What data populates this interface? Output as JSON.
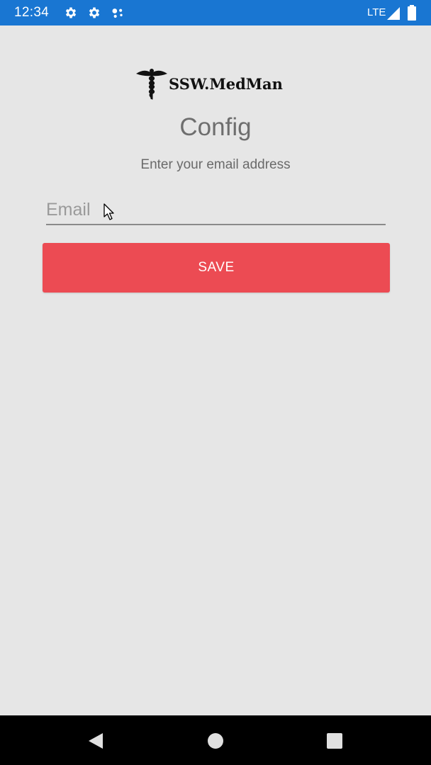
{
  "status_bar": {
    "time": "12:34",
    "network": "LTE",
    "icons": [
      "settings-icon",
      "settings-icon",
      "assistant-dots-icon",
      "signal-icon",
      "battery-icon"
    ],
    "background": "#1976d2"
  },
  "logo": {
    "text": "SSW.MedMan",
    "icon": "caduceus-icon"
  },
  "page": {
    "title": "Config",
    "subtitle": "Enter your email address"
  },
  "form": {
    "email": {
      "value": "",
      "placeholder": "Email"
    },
    "save_label": "SAVE",
    "save_color": "#ec4b53"
  },
  "nav_bar": {
    "buttons": [
      "back-icon",
      "home-icon",
      "recents-icon"
    ]
  }
}
